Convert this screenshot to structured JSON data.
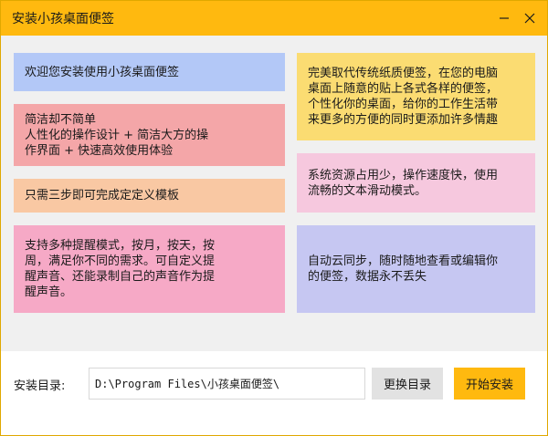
{
  "window": {
    "title": "安装小孩桌面便签",
    "accent_color": "#ffb90f"
  },
  "titlebar": {
    "minimize_icon": "minimize-icon",
    "close_icon": "close-icon"
  },
  "cards": [
    {
      "text": "欢迎您安装使用小孩桌面便签",
      "color": "#b3c8f7"
    },
    {
      "text": "简洁却不简单\n人性化的操作设计 + 简洁大方的操\n作界面 + 快速高效使用体验",
      "color": "#f4a6a8"
    },
    {
      "text": "只需三步即可完成定定义模板",
      "color": "#f9c8a3"
    },
    {
      "text": "支持多种提醒模式，按月，按天，按\n周，满足你不同的需求。可自定义提\n醒声音、还能录制自己的声音作为提\n醒声音。",
      "color": "#f6a9c6"
    },
    {
      "text": "完美取代传统纸质便签，在您的电脑\n桌面上随意的贴上各式各样的便签，\n个性化你的桌面，给你的工作生活带\n来更多的方便的同时更添加许多情趣",
      "color": "#fbdc72"
    },
    {
      "text": "系统资源占用少，操作速度快，使用\n流畅的文本滑动模式。",
      "color": "#f6c8de"
    },
    {
      "text": "自动云同步，随时随地查看或编辑你\n的便签，数据永不丢失",
      "color": "#c6c7f2"
    }
  ],
  "install": {
    "dir_label": "安装目录:",
    "dir_value": "D:\\Program Files\\小孩桌面便签\\",
    "change_button": "更换目录",
    "install_button": "开始安装"
  }
}
